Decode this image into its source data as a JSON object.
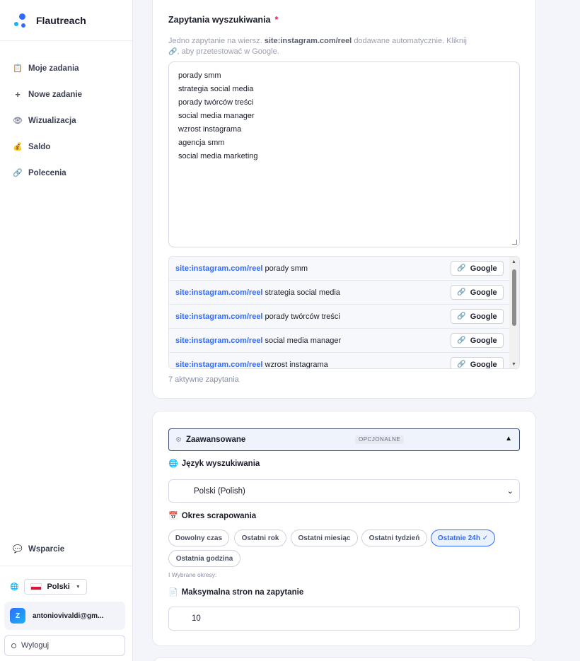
{
  "brand": {
    "name": "Flautreach"
  },
  "sidebar": {
    "items": [
      {
        "label": "Moje zadania",
        "icon": "clipboard-icon"
      },
      {
        "label": "Nowe zadanie",
        "icon": "plus-icon"
      },
      {
        "label": "Wizualizacja",
        "icon": "eye-icon"
      },
      {
        "label": "Saldo",
        "icon": "money-bag-icon"
      },
      {
        "label": "Polecenia",
        "icon": "link-icon"
      }
    ],
    "support": {
      "label": "Wsparcie",
      "icon": "speech-bubble-icon"
    },
    "language": {
      "label": "Polski"
    },
    "user": {
      "initial": "Z",
      "email": "antoniovivaldi@gm..."
    },
    "logout": {
      "label": "Wyloguj"
    }
  },
  "queries_card": {
    "title": "Zapytania wyszukiwania",
    "required_mark": "*",
    "hint_prefix": "Jedno zapytanie na wiersz.",
    "hint_site": "site:instagram.com/reel",
    "hint_suffix": "dodawane automatycznie. Kliknij",
    "hint_suffix2": ", aby przetestować w Google.",
    "queries": [
      "porady smm",
      "strategia social media",
      "porady twórców treści",
      "social media manager",
      "wzrost instagrama",
      "agencja smm",
      "social media marketing"
    ],
    "preview_prefix": "site:instagram.com/reel",
    "google_label": "Google",
    "active_count": "7 aktywne zapytania"
  },
  "advanced_card": {
    "title": "Zaawansowane",
    "badge": "OPCJONALNE",
    "language_label": "Język wyszukiwania",
    "language_value": "Polski (Polish)",
    "period_label": "Okres scrapowania",
    "periods": [
      {
        "label": "Dowolny czas",
        "active": false
      },
      {
        "label": "Ostatni rok",
        "active": false
      },
      {
        "label": "Ostatni miesiąc",
        "active": false
      },
      {
        "label": "Ostatni tydzień",
        "active": false
      },
      {
        "label": "Ostatnie 24h ✓",
        "active": true
      },
      {
        "label": "Ostatnia godzina",
        "active": false
      }
    ],
    "selected_note": "I Wybrane okresy:",
    "max_pages_label": "Maksymalna stron na zapytanie",
    "max_pages_value": "10"
  },
  "colors": {
    "accent": "#2f6bff",
    "required": "#e11d48"
  }
}
